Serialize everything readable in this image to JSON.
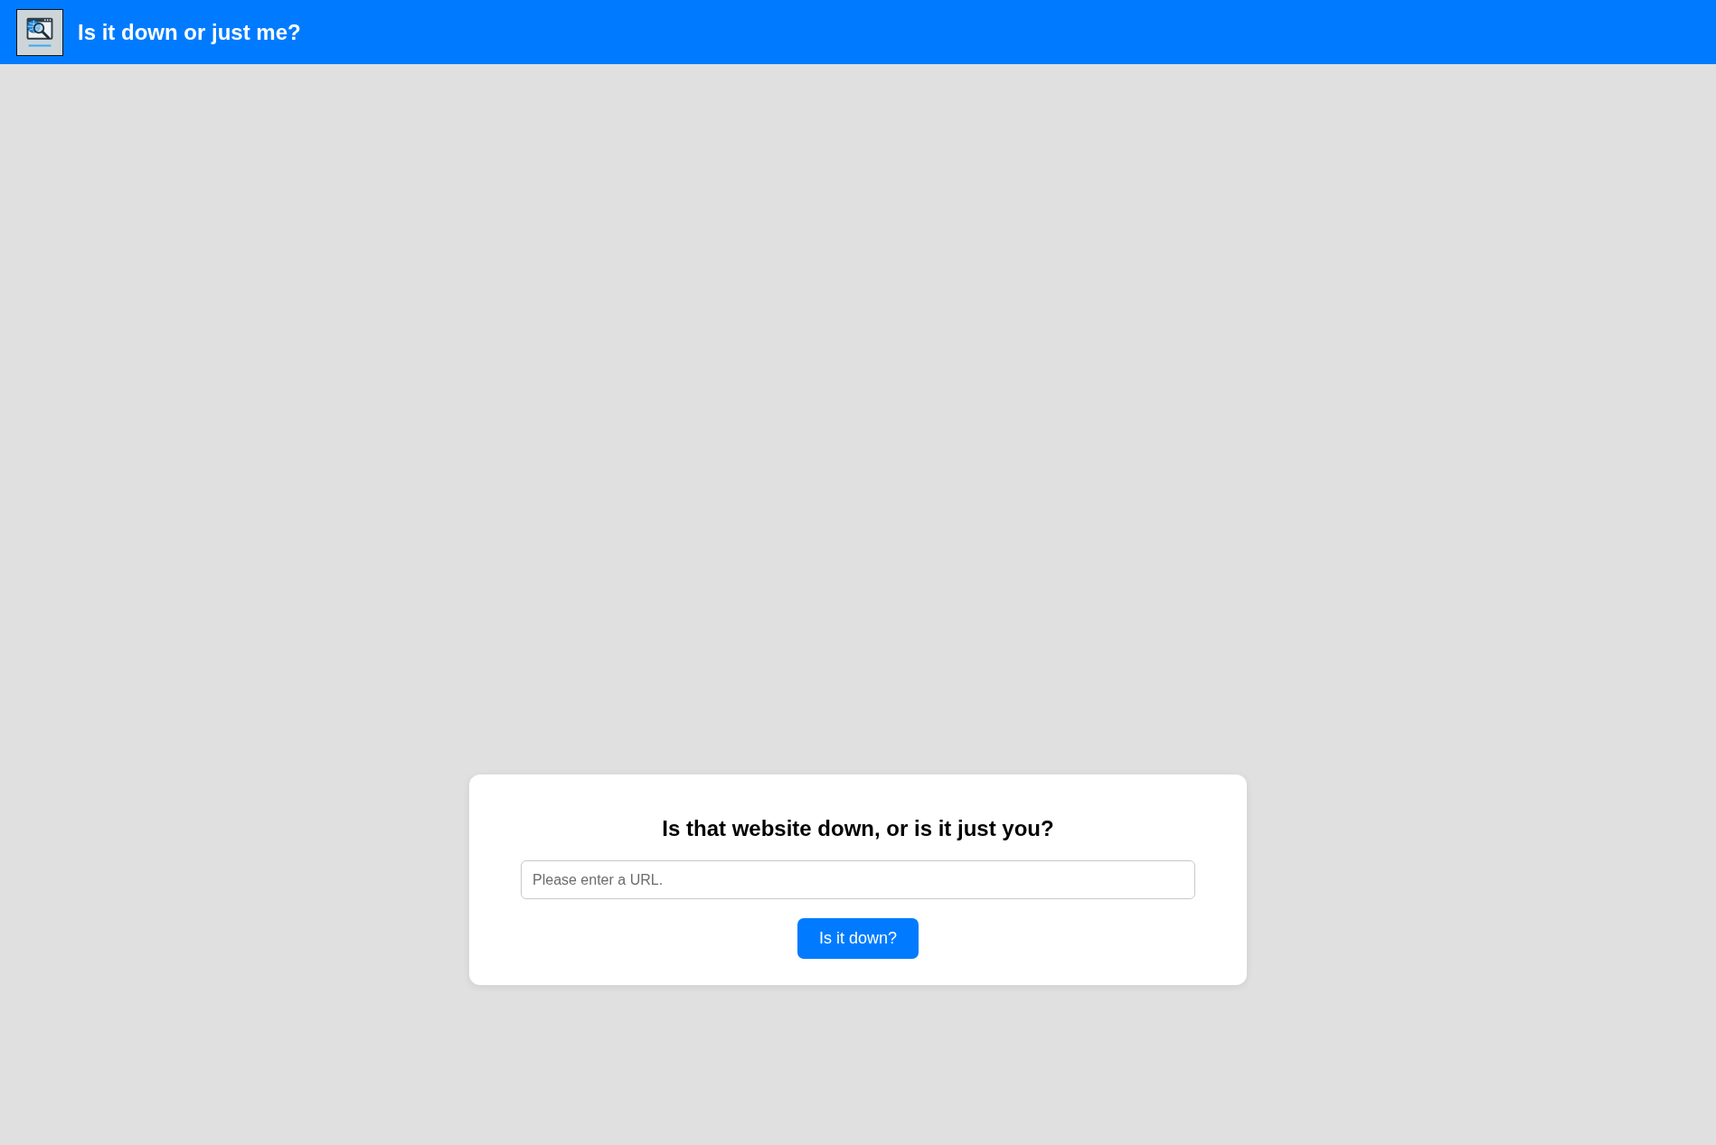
{
  "header": {
    "title": "Is it down or just me?"
  },
  "card": {
    "heading": "Is that website down, or is it just you?",
    "url_field": {
      "placeholder": "Please enter a URL."
    },
    "button": "Is it down?"
  }
}
